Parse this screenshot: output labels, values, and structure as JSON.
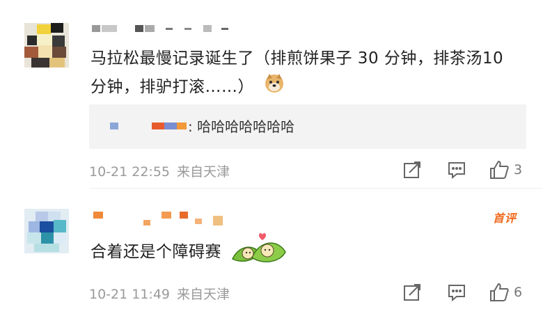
{
  "comments": [
    {
      "text": "马拉松最慢记录诞生了（排煎饼果子 30 分钟，排茶汤10 分钟，排驴打滚……）",
      "emoji": "doge-emoji",
      "reply": {
        "text": ": 哈哈哈哈哈哈哈"
      },
      "date": "10-21 22:55",
      "source": "来自天津",
      "like_count": "3"
    },
    {
      "badge": "首评",
      "text": "合着还是个障碍赛",
      "emoji": "zongzi-love-emoji",
      "date": "10-21 11:49",
      "source": "来自天津",
      "like_count": "6"
    }
  ],
  "colors": {
    "meta_gray": "#9a9a9a",
    "reply_bg": "#f3f3f3",
    "badge_orange": "#f06a1d"
  }
}
